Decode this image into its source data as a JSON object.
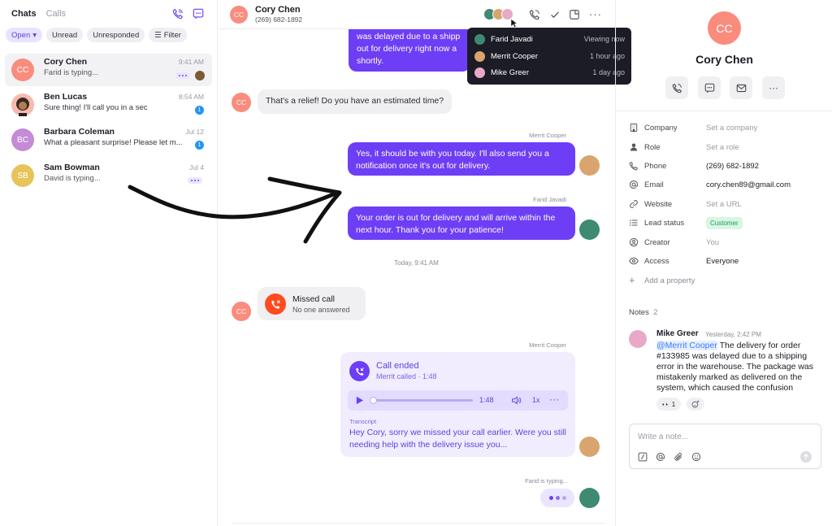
{
  "colors": {
    "accent": "#6d3ef5",
    "missed": "#ff4b1f",
    "customer_tag_bg": "#d9f6e4",
    "customer_tag_fg": "#1a9c54",
    "mention": "#3a7bff",
    "typing_badge": "#2196f3"
  },
  "sidebar": {
    "tabs": [
      "Chats",
      "Calls"
    ],
    "filters": [
      "Open",
      "Unread",
      "Unresponded",
      "Filter"
    ],
    "chats": [
      {
        "initials": "CC",
        "name": "Cory Chen",
        "preview": "Farid is typing...",
        "time": "9:41 AM",
        "avatar_color": "#fa8c7d"
      },
      {
        "initials": "",
        "name": "Ben Lucas",
        "preview": "Sure thing! I'll call you in a sec",
        "time": "8:54 AM",
        "badge": "1"
      },
      {
        "initials": "BC",
        "name": "Barbara Coleman",
        "preview": "What a pleasant surprise! Please let m...",
        "time": "Jul 12",
        "badge": "1",
        "avatar_color": "#c58bd6"
      },
      {
        "initials": "SB",
        "name": "Sam Bowman",
        "preview": "David is typing...",
        "time": "Jul 4",
        "avatar_color": "#e6c45a"
      }
    ]
  },
  "conversation": {
    "header": {
      "initials": "CC",
      "name": "Cory Chen",
      "phone": "(269) 682-1892"
    },
    "viewers": [
      {
        "name": "Farid Javadi",
        "status": "Viewing now"
      },
      {
        "name": "Merrit Cooper",
        "status": "1 hour ago"
      },
      {
        "name": "Mike Greer",
        "status": "1 day ago"
      }
    ],
    "messages": {
      "m1": "was delayed due to a shipp out for delivery right now a shortly.",
      "m2": "That's a relief! Do you have an estimated time?",
      "m3_sender": "Merrit Cooper",
      "m3": "Yes, it should be with you today. I'll also send you a notification once it's out for delivery.",
      "m4_sender": "Farid Javadi",
      "m4": "Your order is out for delivery and will arrive within the next hour. Thank you for your patience!",
      "date_divider": "Today, 9:41 AM",
      "missed_title": "Missed call",
      "missed_sub": "No one answered",
      "call_sender": "Merrit Cooper",
      "call_title": "Call ended",
      "call_sub": "Merrit called · 1:48",
      "audio_duration": "1:48",
      "audio_speed": "1x",
      "transcript_label": "Transcript",
      "transcript": "Hey Cory, sorry we missed your call earlier. Were you still needing help with the delivery issue you...",
      "typing_label": "Farid is typing..."
    }
  },
  "contact": {
    "initials": "CC",
    "name": "Cory Chen",
    "props": [
      {
        "label": "Company",
        "value": "Set a company",
        "muted": true,
        "icon": "building-icon"
      },
      {
        "label": "Role",
        "value": "Set a role",
        "muted": true,
        "icon": "person-icon"
      },
      {
        "label": "Phone",
        "value": "(269) 682-1892",
        "muted": false,
        "icon": "phone-icon"
      },
      {
        "label": "Email",
        "value": "cory.chen89@gmail.com",
        "muted": false,
        "icon": "at-icon"
      },
      {
        "label": "Website",
        "value": "Set a URL",
        "muted": true,
        "icon": "link-icon"
      },
      {
        "label": "Lead status",
        "value": "Customer",
        "tag": true,
        "icon": "list-icon"
      },
      {
        "label": "Creator",
        "value": "You",
        "muted": true,
        "icon": "user-circle-icon"
      },
      {
        "label": "Access",
        "value": "Everyone",
        "muted": false,
        "icon": "eye-icon"
      }
    ],
    "add_property": "Add a property",
    "notes_label": "Notes",
    "notes_count": "2",
    "note": {
      "author": "Mike Greer",
      "time": "Yesterday, 2:42 PM",
      "mention": "@Merrit Cooper",
      "text": " The delivery for order #133985 was delayed due to a shipping error in the warehouse. The package was mistakenly marked as delivered on the system, which caused the confusion",
      "reaction_count": "1"
    },
    "note_placeholder": "Write a note..."
  }
}
